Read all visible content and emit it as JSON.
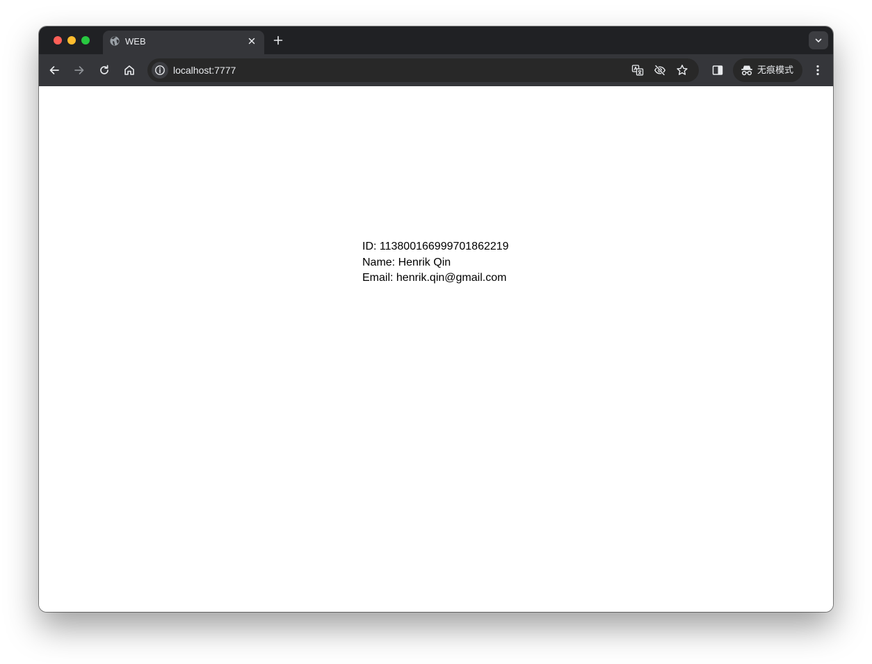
{
  "browser": {
    "tab": {
      "title": "WEB",
      "icon": "globe-icon"
    },
    "address_bar": {
      "url": "localhost:7777"
    },
    "profile": {
      "label": "无痕模式",
      "icon": "incognito-icon"
    }
  },
  "page": {
    "user": {
      "id_line": "ID: 113800166999701862219",
      "name_line": "Name: Henrik Qin",
      "email_line": "Email: henrik.qin@gmail.com"
    }
  },
  "colors": {
    "tabstrip": "#202124",
    "toolbar": "#35363a",
    "omnibox": "#282828",
    "page_background": "#ffffff",
    "text": "#000000"
  }
}
